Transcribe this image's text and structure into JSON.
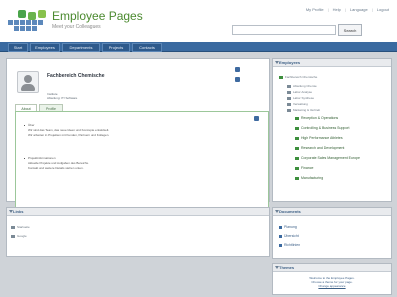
{
  "header": {
    "title": "Employee Pages",
    "subtitle": "Meet your Colleagues",
    "top_links": [
      "My Profile",
      "Help",
      "Language",
      "Logout"
    ],
    "search_button": "Search"
  },
  "nav": {
    "tabs": [
      "Start",
      "Employees",
      "Departments",
      "Projects",
      "Contacts"
    ]
  },
  "profile": {
    "name": "Fachbereich Chemische",
    "department_line1": "Institute",
    "department_line2": "Abteilung: IT/ Software"
  },
  "tabs": [
    "About",
    "Profile"
  ],
  "content": {
    "section1_title": "Über",
    "section1_line1": "Wir sind das Team, das neue Ideen und Konzepte entwickelt.",
    "section1_line2": "Wir arbeiten in Projekten mit Kunden, Partnern und Kollegen.",
    "section2_title": "Projektinformationen",
    "section2_line1": "Aktuelle Projekte und Aufgaben des Bereichs.",
    "section2_line2": "Kontakt und weitere Details stehen unten."
  },
  "links": {
    "title": "Links",
    "items": [
      "Startseite",
      "Google"
    ]
  },
  "employees": {
    "title": "Employees",
    "root": "Fachbereich Chemische",
    "items": [
      "Abteilung Chemie",
      "Labor Analyse",
      "Labor Synthese",
      "Verwaltung",
      "Marketing & Vertrieb"
    ],
    "green_items": [
      "Reception & Operations",
      "Controlling & Business Support",
      "High Performance Athletes",
      "Research and Development",
      "Corporate Sales Management Europe",
      "Finance",
      "Manufacturing"
    ]
  },
  "documents": {
    "title": "Documents",
    "items": [
      "Planung",
      "Übersicht",
      "Richtlinien"
    ]
  },
  "themes": {
    "title": "Themes",
    "line1": "Welcome to the Employee Pages.",
    "line2": "Choose a theme for your page.",
    "link": "Change appearance"
  },
  "colors": {
    "accent": "#3a6aa0",
    "green": "#4aa44a"
  }
}
